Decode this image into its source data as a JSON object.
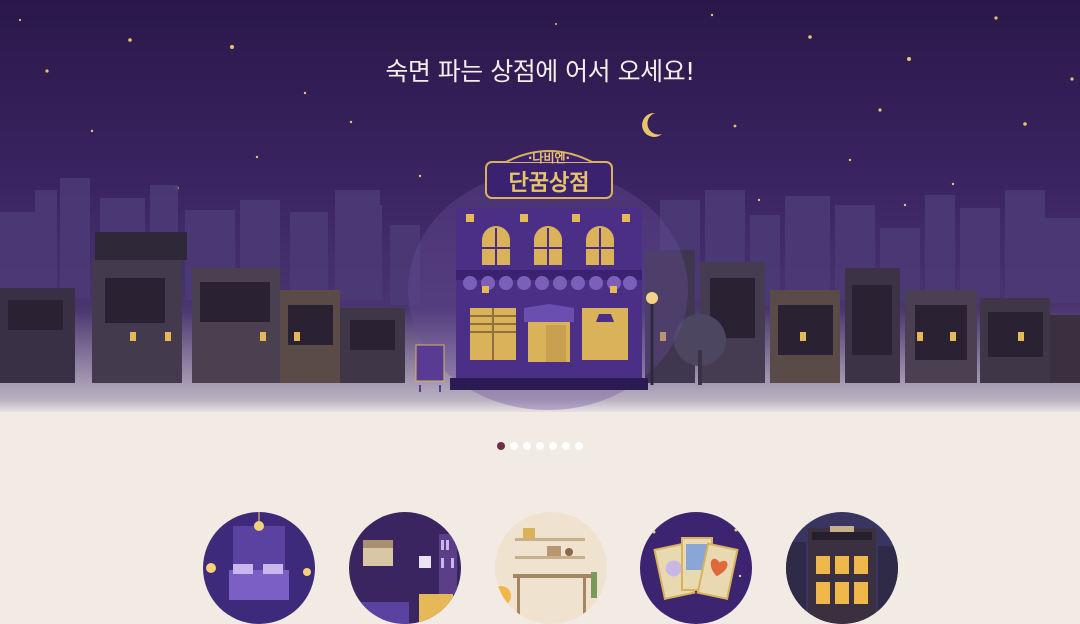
{
  "hero": {
    "headline": "숙면 파는 상점에 어서 오세요!",
    "sign_top": "·나비엔·",
    "sign_main": "단꿈상점",
    "colors": {
      "sky_top": "#2b1849",
      "sky_mid": "#3a2462",
      "glow": "#d9b25a",
      "store": "#4a2d86"
    }
  },
  "carousel": {
    "slide_count": 7,
    "active_index": 0
  },
  "categories": [
    {
      "icon": "bedroom-night-icon"
    },
    {
      "icon": "study-room-icon"
    },
    {
      "icon": "kitchen-shelf-icon"
    },
    {
      "icon": "tarot-cards-icon"
    },
    {
      "icon": "night-building-icon"
    }
  ]
}
